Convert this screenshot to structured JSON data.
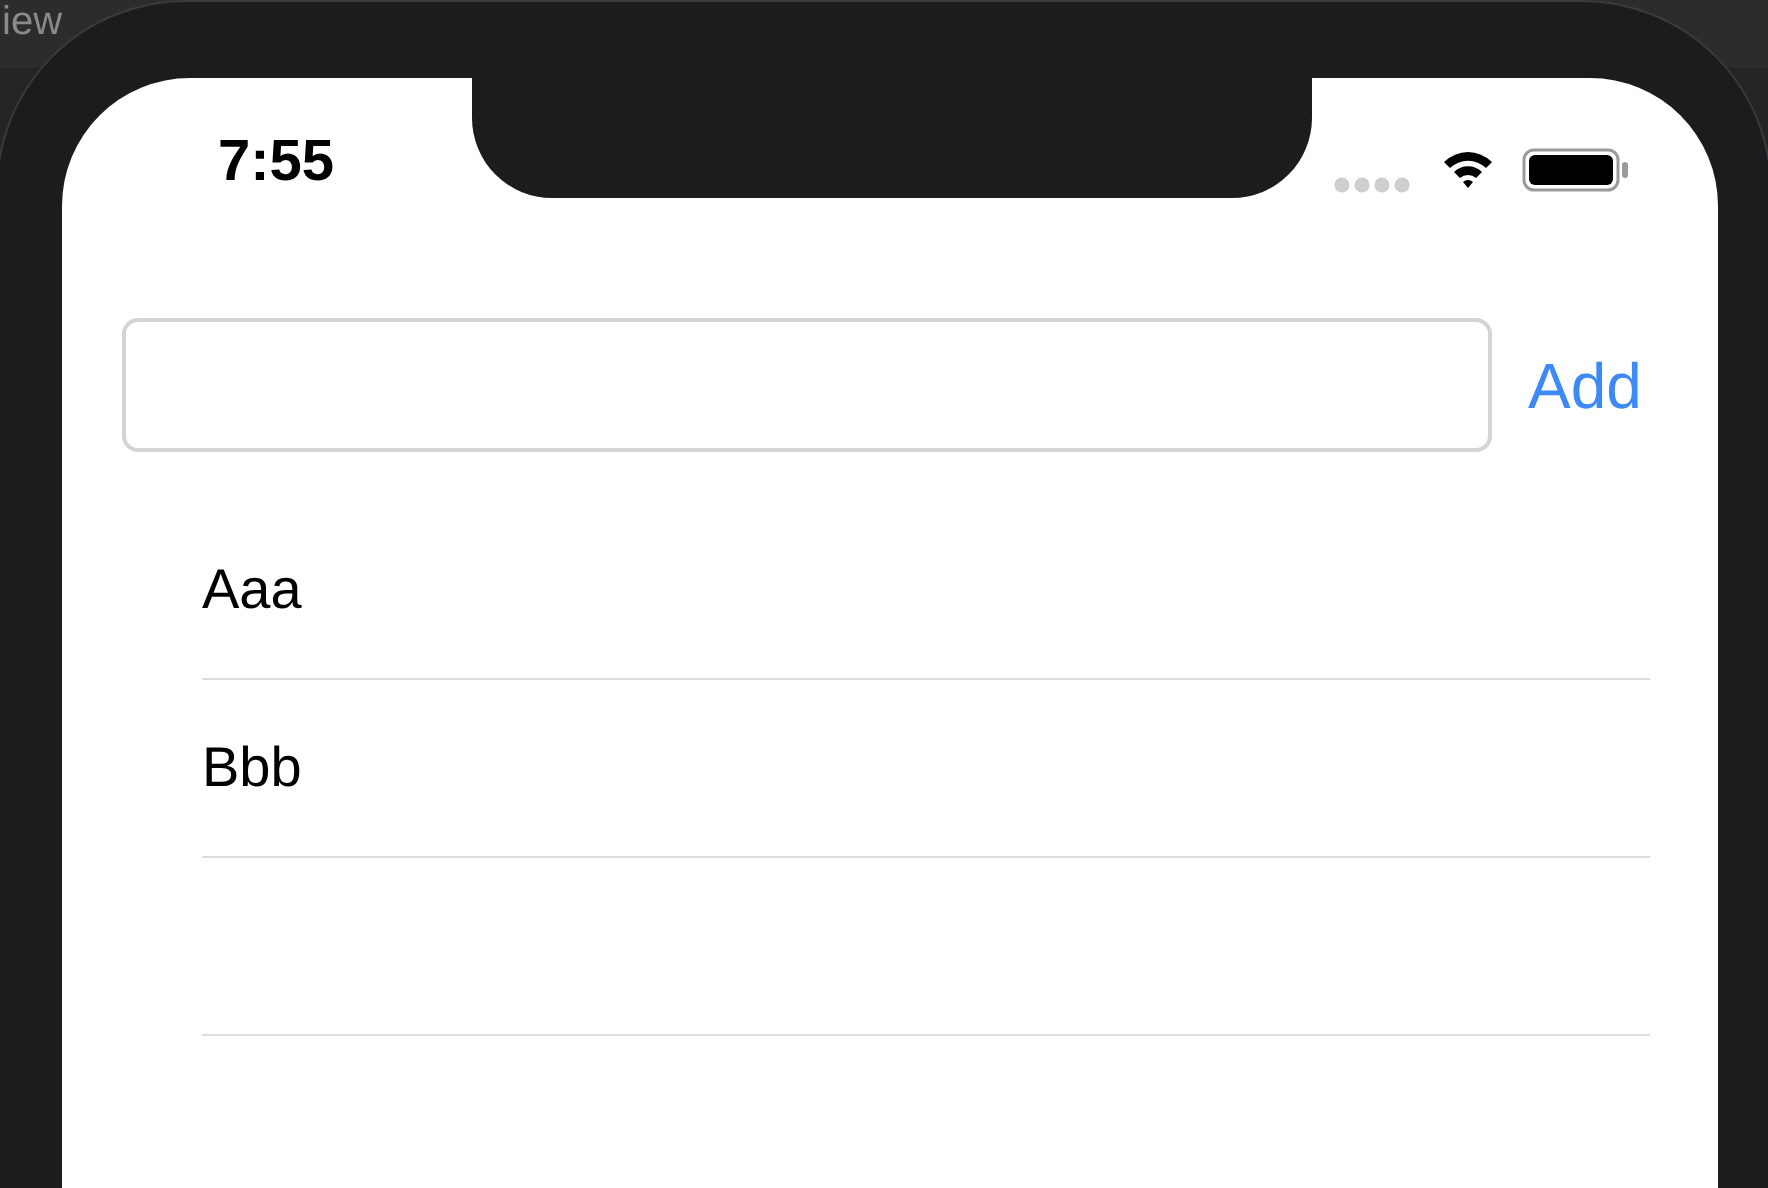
{
  "background_text": "iew",
  "status_bar": {
    "time": "7:55"
  },
  "add_button": {
    "label": "Add"
  },
  "list": [
    {
      "label": "Aaa"
    },
    {
      "label": "Bbb"
    }
  ]
}
